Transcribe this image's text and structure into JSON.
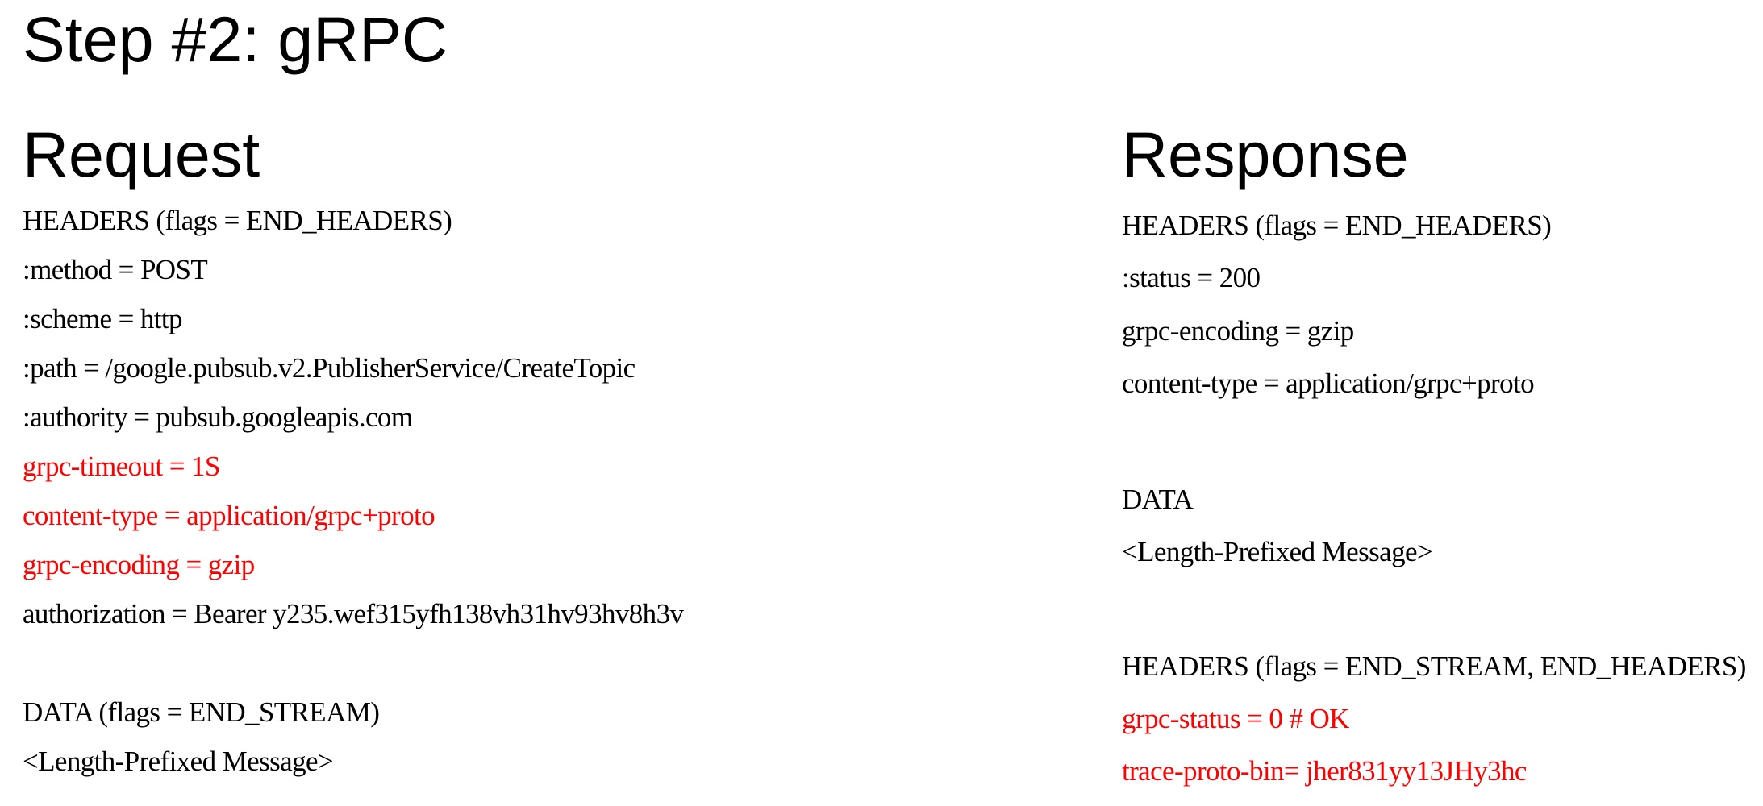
{
  "slide": {
    "title": "Step #2: gRPC"
  },
  "request": {
    "heading": "Request",
    "lines": [
      {
        "text": "HEADERS (flags = END_HEADERS)",
        "color": "#000000"
      },
      {
        "text": ":method = POST",
        "color": "#000000"
      },
      {
        "text": ":scheme = http",
        "color": "#000000"
      },
      {
        "text": ":path = /google.pubsub.v2.PublisherService/CreateTopic",
        "color": "#000000"
      },
      {
        "text": ":authority = pubsub.googleapis.com",
        "color": "#000000"
      },
      {
        "text": "grpc-timeout = 1S",
        "color": "#ff0000"
      },
      {
        "text": "content-type = application/grpc+proto",
        "color": "#ff0000"
      },
      {
        "text": "grpc-encoding = gzip",
        "color": "#ff0000"
      },
      {
        "text": "authorization = Bearer y235.wef315yfh138vh31hv93hv8h3v",
        "color": "#000000"
      },
      {
        "text": "DATA (flags = END_STREAM)",
        "color": "#000000"
      },
      {
        "text": "<Length-Prefixed Message>",
        "color": "#000000"
      }
    ]
  },
  "response": {
    "heading": "Response",
    "lines": [
      {
        "text": "HEADERS (flags = END_HEADERS)",
        "color": "#000000"
      },
      {
        "text": ":status = 200",
        "color": "#000000"
      },
      {
        "text": "grpc-encoding = gzip",
        "color": "#000000"
      },
      {
        "text": "content-type = application/grpc+proto",
        "color": "#000000"
      },
      {
        "text": "DATA",
        "color": "#000000"
      },
      {
        "text": "<Length-Prefixed Message>",
        "color": "#000000"
      },
      {
        "text": "HEADERS (flags = END_STREAM, END_HEADERS)",
        "color": "#000000"
      },
      {
        "text": "grpc-status = 0 # OK",
        "color": "#ff0000"
      },
      {
        "text": "trace-proto-bin= jher831yy13JHy3hc",
        "color": "#ff0000"
      }
    ]
  },
  "colors": {
    "text": "#000000",
    "highlight": "#ff0000",
    "background": "#ffffff"
  }
}
